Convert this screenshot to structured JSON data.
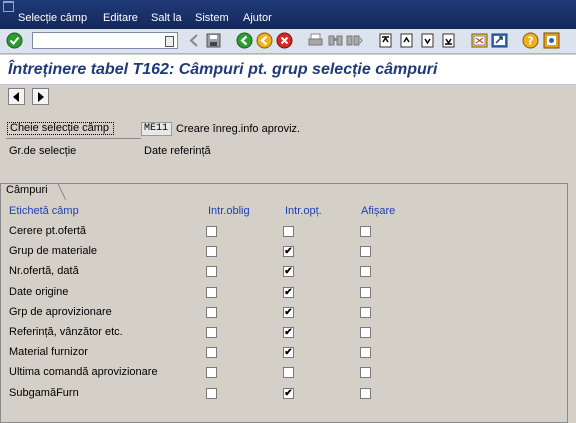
{
  "menu": [
    "Selecție câmp",
    "Editare",
    "Salt la",
    "Sistem",
    "Ajutor"
  ],
  "command_field": {
    "value": ""
  },
  "title": "Întreținere tabel T162: Câmpuri pt. grup selecție câmpuri",
  "header": {
    "key_label": "Cheie selecție câmp",
    "key_value": "ME11",
    "key_description": "Creare înreg.info aproviz.",
    "group_label": "Gr.de selecție",
    "group_value": "Date referință"
  },
  "fields_box": {
    "tab_label": "Câmpuri",
    "columns": [
      "Etichetă câmp",
      "Intr.oblig",
      "Intr.opț.",
      "Afișare"
    ],
    "rows": [
      {
        "label": "Cerere pt.ofertă",
        "mandatory": false,
        "optional": false,
        "display": false
      },
      {
        "label": "Grup de materiale",
        "mandatory": false,
        "optional": true,
        "display": false
      },
      {
        "label": "Nr.ofertă, dată",
        "mandatory": false,
        "optional": true,
        "display": false
      },
      {
        "label": "Date origine",
        "mandatory": false,
        "optional": true,
        "display": false
      },
      {
        "label": "Grp de aprovizionare",
        "mandatory": false,
        "optional": true,
        "display": false
      },
      {
        "label": "Referință, vânzător etc.",
        "mandatory": false,
        "optional": true,
        "display": false
      },
      {
        "label": "Material furnizor",
        "mandatory": false,
        "optional": true,
        "display": false
      },
      {
        "label": "Ultima comandă aprovizionare",
        "mandatory": false,
        "optional": false,
        "display": false
      },
      {
        "label": "SubgamăFurn",
        "mandatory": false,
        "optional": true,
        "display": false
      }
    ]
  },
  "colors": {
    "menubar": "#1f3a78",
    "title": "#1f3a78",
    "column_header": "#1f3fae",
    "background": "#d4d0c8"
  }
}
